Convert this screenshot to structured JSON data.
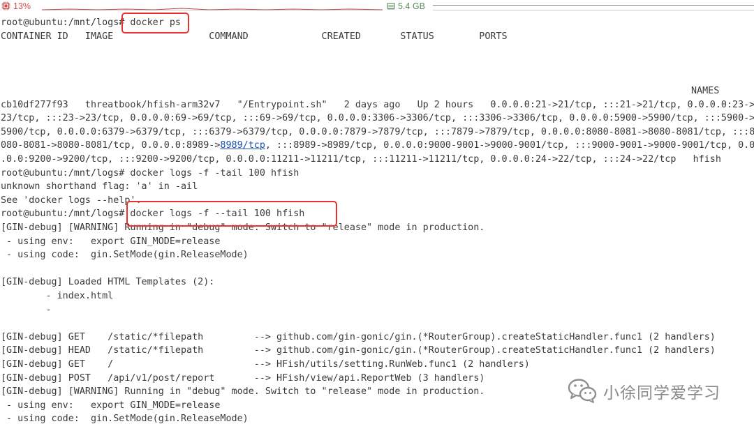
{
  "statusbar": {
    "cpu_icon": "cpu-chip-icon",
    "cpu_value": "13%",
    "cpu_color": "#d14a4a",
    "memory_icon": "memory-module-icon",
    "memory_value": "5.4 GB",
    "memory_color": "#5a8a5a"
  },
  "terminal": {
    "cmd1": "root@ubuntu:/mnt/logs# docker ps",
    "header": "CONTAINER ID   IMAGE                 COMMAND             CREATED       STATUS        PORTS",
    "names_header": "NAMES",
    "row": [
      "cb10df277f93   threatbook/hfish-arm32v7   \"/Entrypoint.sh\"   2 days ago   Up 2 hours   0.0.0.0:21->21/tcp, :::21->21/tcp, 0.0.0.0:23->",
      "23/tcp, :::23->23/tcp, 0.0.0.0:69->69/tcp, :::69->69/tcp, 0.0.0.0:3306->3306/tcp, :::3306->3306/tcp, 0.0.0.0:5900->5900/tcp, :::5900->",
      "5900/tcp, 0.0.0.0:6379->6379/tcp, :::6379->6379/tcp, 0.0.0.0:7879->7879/tcp, :::7879->7879/tcp, 0.0.0.0:8080-8081->8080-8081/tcp, :::8",
      "080-8081->8080-8081/tcp, 0.0.0.0:8989->",
      "8989/tcp",
      ", :::8989->8989/tcp, 0.0.0.0:9000-9001->9000-9001/tcp, :::9000-9001->9000-9001/tcp, 0.0",
      ".0.0:9200->9200/tcp, :::9200->9200/tcp, 0.0.0.0:11211->11211/tcp, :::11211->11211/tcp, 0.0.0.0:24->22/tcp, :::24->22/tcp   hfish"
    ],
    "cmd2": "root@ubuntu:/mnt/logs# docker logs -f -tail 100 hfish",
    "err1": "unknown shorthand flag: 'a' in -ail",
    "err2": "See 'docker logs --help'.",
    "cmd3": "root@ubuntu:/mnt/logs# docker logs -f --tail 100 hfish",
    "log": [
      "[GIN-debug] [WARNING] Running in \"debug\" mode. Switch to \"release\" mode in production.",
      " - using env:   export GIN_MODE=release",
      " - using code:  gin.SetMode(gin.ReleaseMode)",
      "",
      "[GIN-debug] Loaded HTML Templates (2):",
      "        - index.html",
      "        - ",
      "",
      "[GIN-debug] GET    /static/*filepath         --> github.com/gin-gonic/gin.(*RouterGroup).createStaticHandler.func1 (2 handlers)",
      "[GIN-debug] HEAD   /static/*filepath         --> github.com/gin-gonic/gin.(*RouterGroup).createStaticHandler.func1 (2 handlers)",
      "[GIN-debug] GET    /                         --> HFish/utils/setting.RunWeb.func1 (2 handlers)",
      "[GIN-debug] POST   /api/v1/post/report       --> HFish/view/api.ReportWeb (3 handlers)",
      "[GIN-debug] [WARNING] Running in \"debug\" mode. Switch to \"release\" mode in production.",
      " - using env:   export GIN_MODE=release",
      " - using code:  gin.SetMode(gin.ReleaseMode)"
    ],
    "highlight_color": "#e8322f",
    "link_color": "#1a4fb4"
  },
  "watermark": {
    "icon": "wechat-icon",
    "text": "小徐同学爱学习"
  }
}
